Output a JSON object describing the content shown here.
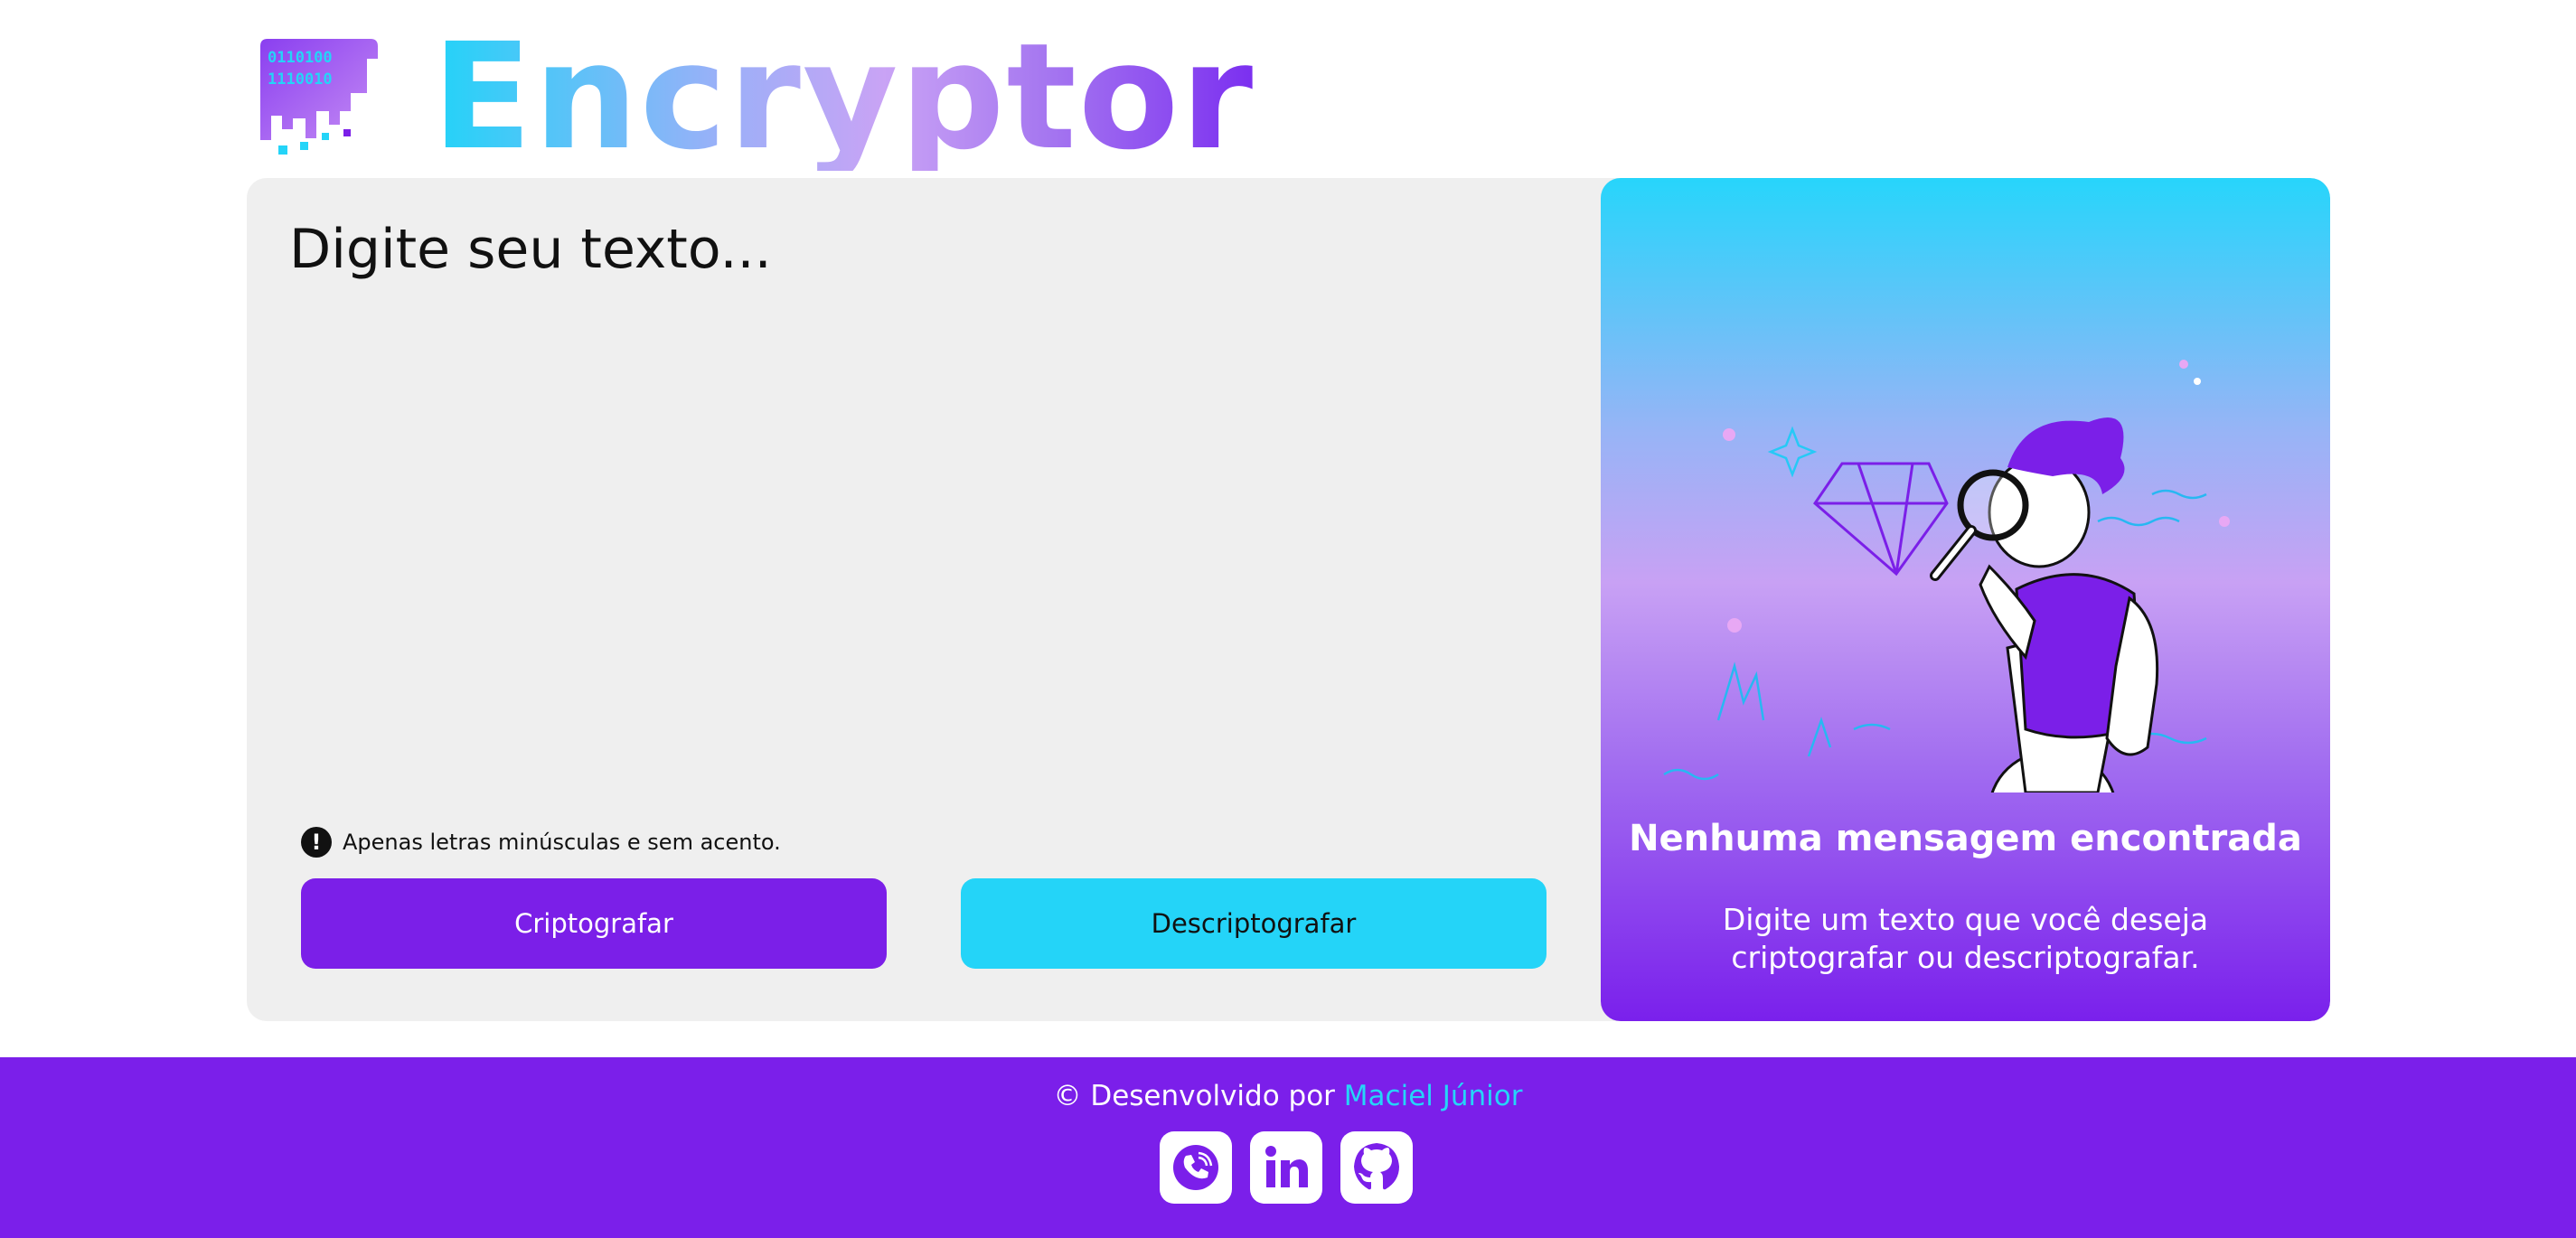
{
  "header": {
    "brand": "Encryptor",
    "logo_icon": "binary-glitch-logo-icon"
  },
  "input": {
    "placeholder": "Digite seu texto...",
    "value": "",
    "hint": "Apenas letras minúsculas e sem acento.",
    "hint_icon": "exclamation-icon"
  },
  "actions": {
    "encrypt_label": "Criptografar",
    "decrypt_label": "Descriptografar"
  },
  "output": {
    "illustration": "person-with-magnifier-illustration",
    "title": "Nenhuma mensagem encontrada",
    "message": "Digite um texto que você deseja criptografar ou descriptografar."
  },
  "footer": {
    "credit_prefix": "© Desenvolvido por",
    "author": "Maciel Júnior",
    "socials": [
      "phone-icon",
      "linkedin-icon",
      "github-icon"
    ]
  },
  "colors": {
    "purple": "#7b1fe8",
    "cyan": "#24d4f8",
    "card_bg": "#efefef"
  }
}
